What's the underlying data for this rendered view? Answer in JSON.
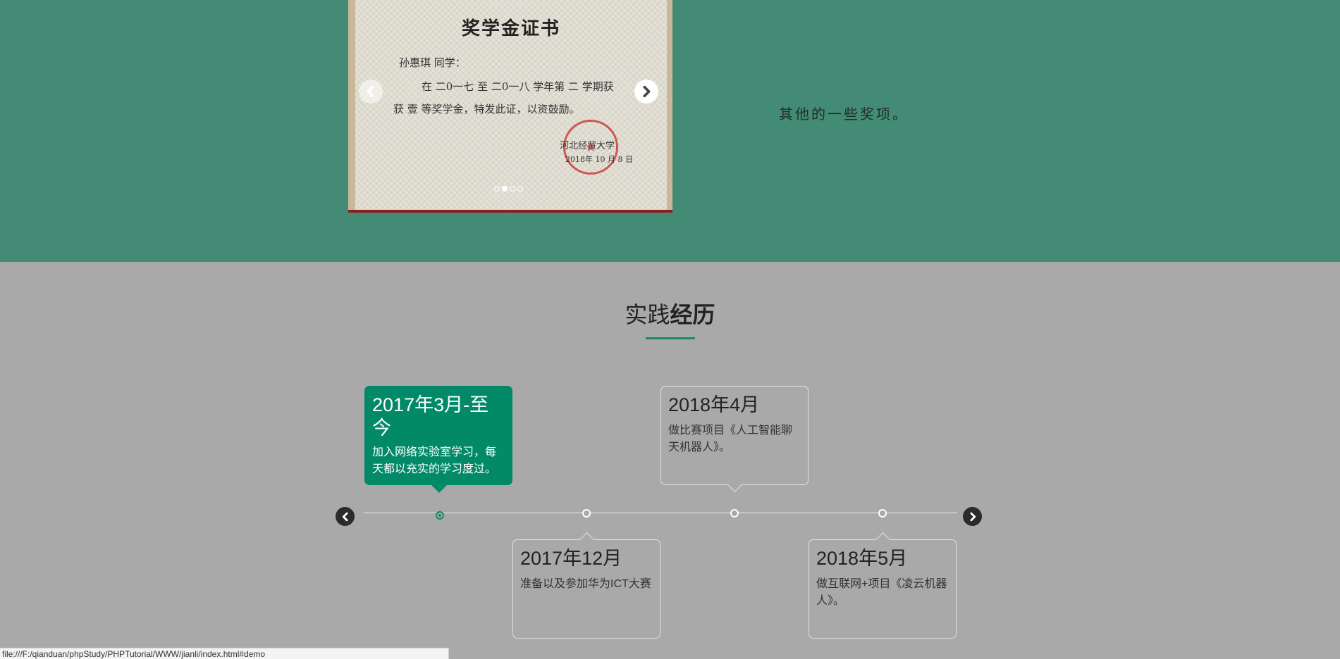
{
  "awards": {
    "certificate": {
      "title": "奖学金证书",
      "line1": "孙惠琪 同学：",
      "line2": "在 二0一七 至 二0一八 学年第 二 学期获",
      "line3": "获 壹 等奖学金，特发此证，以资鼓励。",
      "line4": "河北经贸大学",
      "line5": "2018年 10 月 8 日"
    },
    "caption": "其他的一些奖项。",
    "dots_count": 4,
    "active_dot": 1
  },
  "practice": {
    "title_normal": "实践",
    "title_bold": "经历",
    "items": [
      {
        "date": "2017年3月-至今",
        "desc": "加入网络实验室学习，每天都以充实的学习度过。",
        "active": true
      },
      {
        "date": "2017年12月",
        "desc": "准备以及参加华为ICT大赛",
        "active": false
      },
      {
        "date": "2018年4月",
        "desc": "做比赛项目《人工智能聊天机器人》。",
        "active": false
      },
      {
        "date": "2018年5月",
        "desc": "做互联网+项目《凌云机器人》。",
        "active": false
      }
    ]
  },
  "colors": {
    "green_section": "#438b74",
    "gray_section": "#a9a9a9",
    "accent": "#028a68"
  },
  "icons": {
    "slide_prev": "chevron-left-icon",
    "slide_next": "chevron-right-icon",
    "timeline_prev": "chevron-left-icon",
    "timeline_next": "chevron-right-icon"
  },
  "statusbar": {
    "url": "file:///F:/qianduan/phpStudy/PHPTutorial/WWW/jianli/index.html#demo"
  }
}
